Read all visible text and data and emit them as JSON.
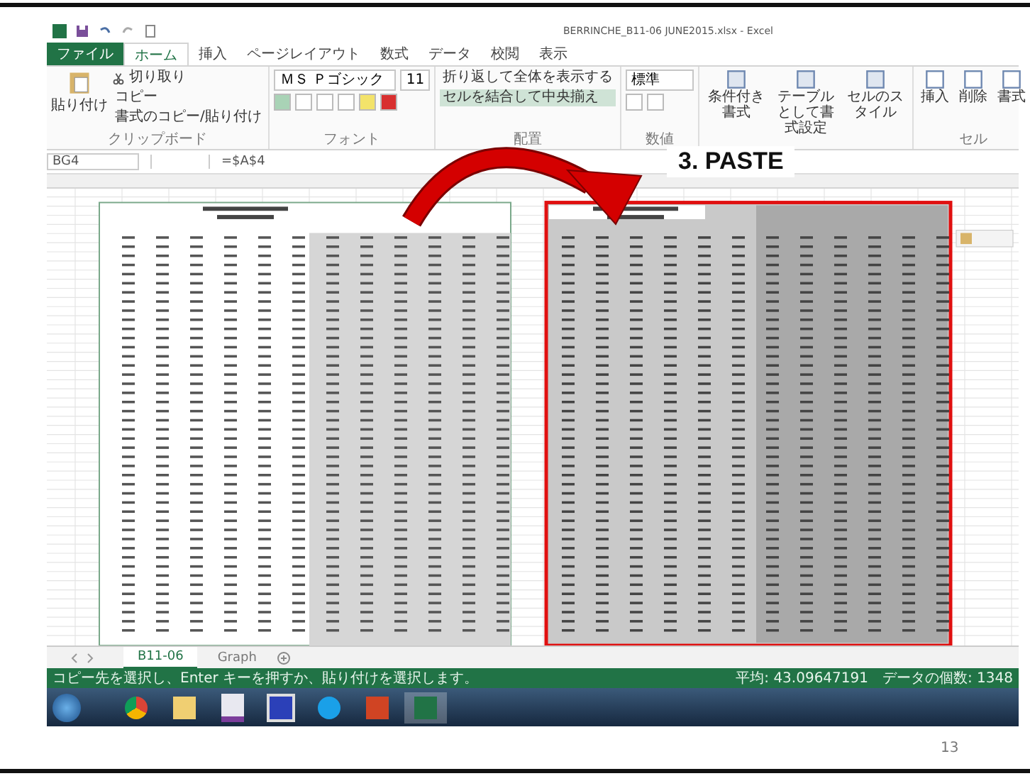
{
  "window": {
    "title": "BERRINCHE_B11-06 JUNE2015.xlsx - Excel"
  },
  "tabs": [
    {
      "label": "ファイル",
      "kind": "file",
      "selected": false
    },
    {
      "label": "ホーム",
      "kind": "tab",
      "selected": true
    },
    {
      "label": "挿入",
      "kind": "tab",
      "selected": false
    },
    {
      "label": "ページレイアウト",
      "kind": "tab",
      "selected": false
    },
    {
      "label": "数式",
      "kind": "tab",
      "selected": false
    },
    {
      "label": "データ",
      "kind": "tab",
      "selected": false
    },
    {
      "label": "校閲",
      "kind": "tab",
      "selected": false
    },
    {
      "label": "表示",
      "kind": "tab",
      "selected": false
    }
  ],
  "clipboard": {
    "paste": "貼り付け",
    "cut": "切り取り",
    "copy": "コピー",
    "format_painter": "書式のコピー/貼り付け",
    "label": "クリップボード"
  },
  "font": {
    "name": "ＭＳ Ｐゴシック",
    "size": "11",
    "label": "フォント"
  },
  "alignment": {
    "wrap": "折り返して全体を表示する",
    "merge": "セルを結合して中央揃え",
    "label": "配置"
  },
  "number": {
    "format": "標準",
    "label": "数値"
  },
  "styles": {
    "items": [
      "条件付き書式",
      "テーブルとして書式設定",
      "セルのスタイル"
    ]
  },
  "cells": {
    "items": [
      "挿入",
      "削除",
      "書式"
    ],
    "label": "セル"
  },
  "formula_bar": {
    "name_box": "BG4",
    "formula": "=$A$4"
  },
  "callout": {
    "text": "3. PASTE"
  },
  "sheet_tabs": [
    {
      "label": "B11-06",
      "selected": true
    },
    {
      "label": "Graph",
      "selected": false
    }
  ],
  "status_bar": {
    "message": "コピー先を選択し、Enter キーを押すか、貼り付けを選択します。",
    "average": "平均: 43.09647191",
    "count": "データの個数: 1348"
  },
  "slide": {
    "page_number": "13"
  }
}
